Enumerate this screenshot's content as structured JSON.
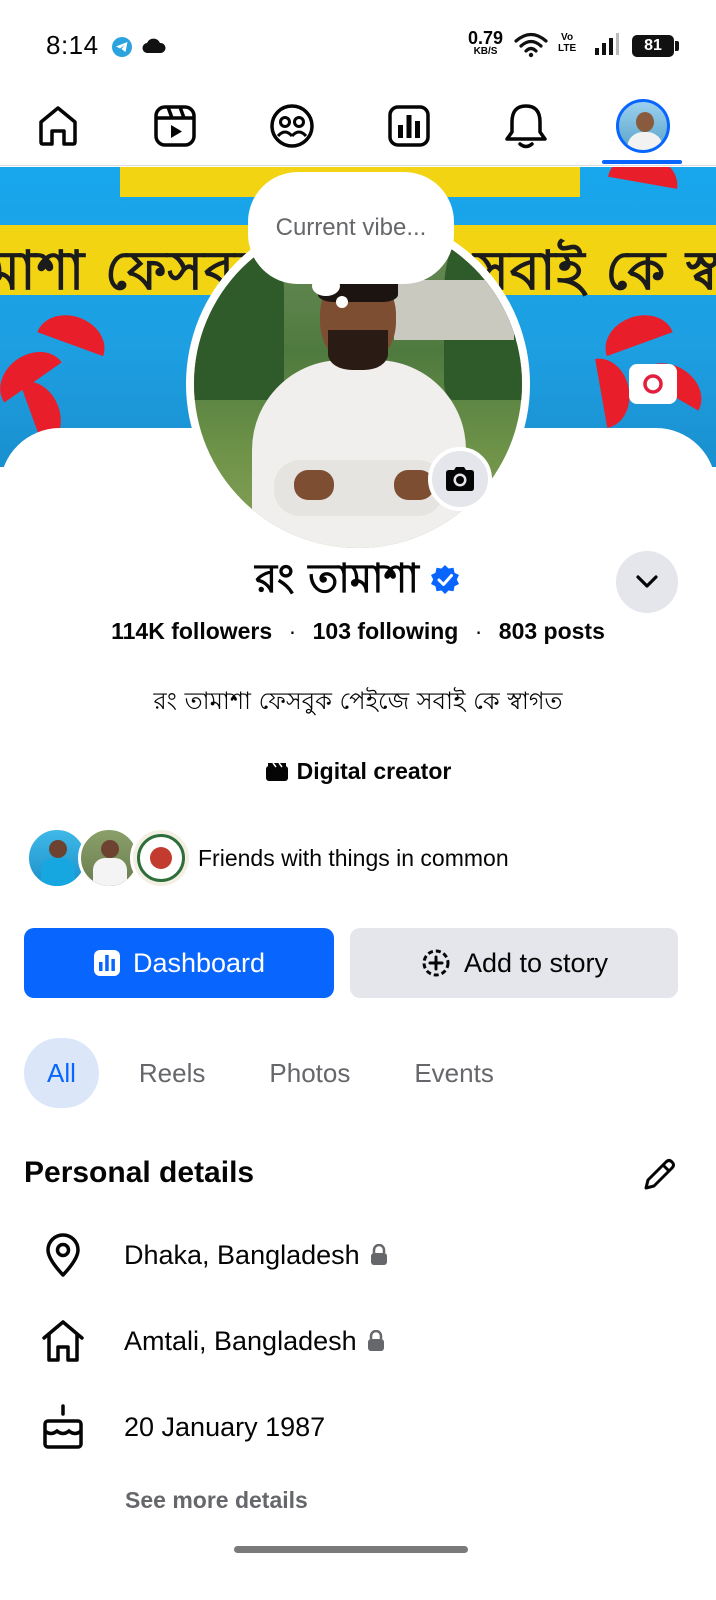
{
  "status_bar": {
    "time": "8:14",
    "net_speed": "0.79",
    "net_unit": "KB/S",
    "volte_top": "Vo",
    "volte_bottom": "LTE",
    "battery": "81",
    "icons": [
      "telegram-icon",
      "cloud-icon",
      "wifi-icon",
      "signal-icon",
      "battery-icon"
    ]
  },
  "top_nav": {
    "items": [
      "home-icon",
      "reels-icon",
      "friends-icon",
      "dashboard-icon",
      "notifications-icon",
      "profile-avatar"
    ],
    "active": "profile-avatar",
    "accent": "#0866ff"
  },
  "cover": {
    "banner_text": "মাশা ফেসবুক পেইজে সবাই কে স্বাগত"
  },
  "vibe_bubble": {
    "placeholder": "Current vibe..."
  },
  "profile": {
    "name": "রং তামাশা",
    "verified": true,
    "followers": "114K followers",
    "following": "103 following",
    "posts": "803 posts",
    "separator": "·",
    "bio": "রং তামাশা ফেসবুক পেইজে সবাই কে স্বাগত",
    "category": "Digital creator",
    "friends_text": "Friends with things in common"
  },
  "actions": {
    "dashboard": "Dashboard",
    "add_story": "Add to story"
  },
  "tabs": [
    {
      "label": "All",
      "active": true
    },
    {
      "label": "Reels",
      "active": false
    },
    {
      "label": "Photos",
      "active": false
    },
    {
      "label": "Events",
      "active": false
    }
  ],
  "personal_details": {
    "title": "Personal details",
    "rows": [
      {
        "icon": "location-pin-icon",
        "text": "Dhaka, Bangladesh",
        "private": true
      },
      {
        "icon": "home-icon",
        "text": "Amtali, Bangladesh",
        "private": true
      },
      {
        "icon": "birthday-cake-icon",
        "text": "20 January 1987",
        "private": false
      }
    ],
    "see_more": "See more details"
  },
  "colors": {
    "primary": "#0866ff",
    "secondary_bg": "#e4e6eb",
    "muted_text": "#65676b",
    "active_tab_bg": "#dbe7f9"
  }
}
